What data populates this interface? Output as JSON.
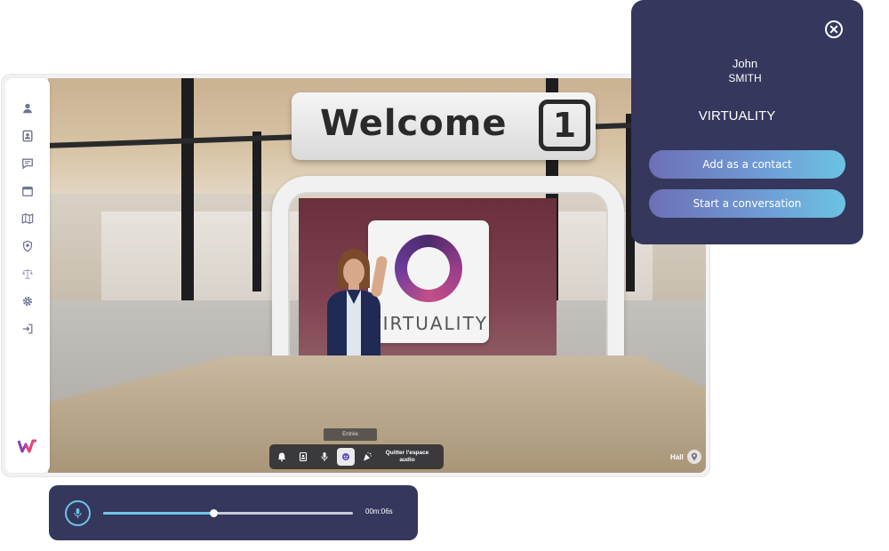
{
  "scene": {
    "sign_text": "Welcome",
    "sign_number": "1",
    "brand_word": "VIRTUALITY",
    "booth_label": "Entrée"
  },
  "toolbar": {
    "buttons": [
      {
        "icon": "bell-icon"
      },
      {
        "icon": "phonebook-icon"
      },
      {
        "icon": "microphone-icon"
      },
      {
        "icon": "support-icon",
        "active": true
      },
      {
        "icon": "party-icon"
      }
    ],
    "quit_line1": "Quitter l'espace",
    "quit_line2": "audio"
  },
  "location": {
    "label": "Hall"
  },
  "sidebar": {
    "items": [
      {
        "icon": "user-icon"
      },
      {
        "icon": "contact-card-icon"
      },
      {
        "icon": "chat-icon"
      },
      {
        "icon": "calendar-icon"
      },
      {
        "icon": "map-icon"
      },
      {
        "icon": "badge-icon"
      },
      {
        "icon": "scales-icon"
      },
      {
        "icon": "gear-icon"
      },
      {
        "icon": "logout-icon"
      }
    ],
    "logo": "W"
  },
  "contact_card": {
    "first_name": "John",
    "last_name": "SMITH",
    "company": "VIRTUALITY",
    "add_contact_label": "Add as a contact",
    "start_conversation_label": "Start a conversation"
  },
  "audio_player": {
    "progress": 0.44,
    "time": "00m:06s",
    "accent": "#6ec4e8"
  },
  "colors": {
    "panel_bg": "#35375d",
    "button_gradient_start": "#6e6fb6",
    "button_gradient_end": "#6cc2e2"
  }
}
